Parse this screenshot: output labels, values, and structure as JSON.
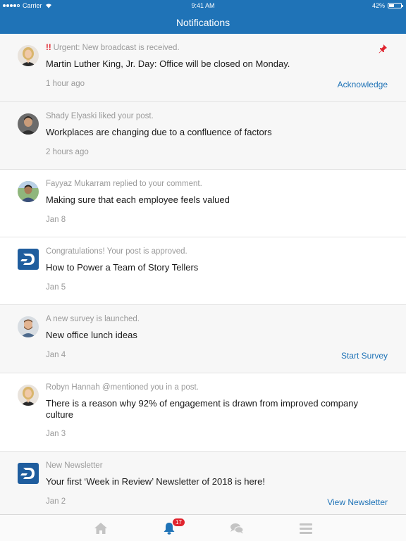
{
  "status_bar": {
    "carrier": "Carrier",
    "time": "9:41 AM",
    "battery": "42%",
    "battery_level": 0.42
  },
  "header": {
    "title": "Notifications"
  },
  "notifications": [
    {
      "avatar": "avatar-woman",
      "urgent_mark": "!!",
      "meta": "Urgent: New broadcast is received.",
      "title": "Martin Luther King, Jr. Day: Office will be closed on Monday.",
      "date": "1 hour ago",
      "action": "Acknowledge",
      "pinned": true
    },
    {
      "avatar": "avatar-man-dark",
      "meta": "Shady Elyaski liked your post.",
      "title": "Workplaces are changing due to a confluence of factors",
      "date": "2 hours ago"
    },
    {
      "avatar": "avatar-man-outdoor",
      "meta": "Fayyaz Mukarram replied to your comment.",
      "title": "Making sure that each employee feels valued",
      "date": "Jan 8"
    },
    {
      "avatar": "d-logo",
      "meta": "Congratulations! Your post is approved.",
      "title": "How to Power a Team of Story Tellers",
      "date": "Jan 5"
    },
    {
      "avatar": "avatar-man-beard",
      "meta": "A new survey is launched.",
      "title": "New office lunch ideas",
      "date": "Jan 4",
      "action": "Start Survey"
    },
    {
      "avatar": "avatar-woman",
      "meta": "Robyn Hannah @mentioned you in a post.",
      "title": "There is a reason why 92% of engagement is drawn from improved company culture",
      "date": "Jan 3"
    },
    {
      "avatar": "d-logo",
      "meta": "New Newsletter",
      "title": "Your first ‘Week in Review’ Newsletter of 2018 is here!",
      "date": "Jan 2",
      "action": "View Newsletter"
    }
  ],
  "tab_bar": {
    "tabs": [
      "home-icon",
      "bell-icon",
      "chat-icon",
      "menu-icon"
    ],
    "active": "bell-icon",
    "badge": "17"
  },
  "colors": {
    "brand": "#1f73b7",
    "urgent": "#e0242e",
    "muted": "#9a9a9a"
  }
}
